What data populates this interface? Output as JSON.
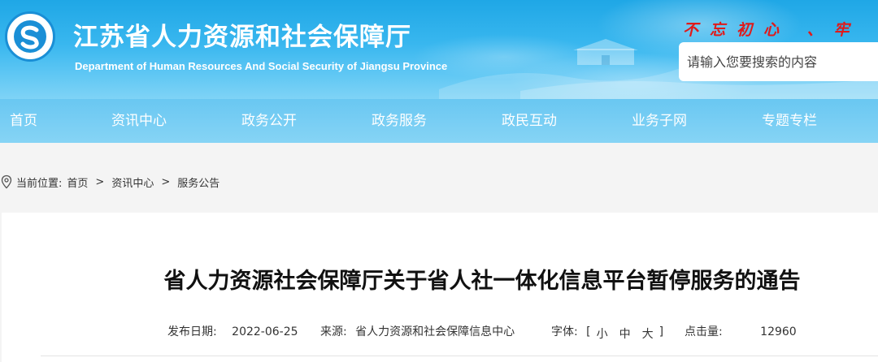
{
  "header": {
    "title_cn": "江苏省人力资源和社会保障厅",
    "title_en": "Department of Human Resources And Social Security of Jiangsu Province",
    "slogan": "不忘初心 、牢",
    "search": {
      "placeholder": "请输入您要搜索的内容",
      "value": ""
    }
  },
  "nav": {
    "items": [
      {
        "label": "首页"
      },
      {
        "label": "资讯中心"
      },
      {
        "label": "政务公开"
      },
      {
        "label": "政务服务"
      },
      {
        "label": "政民互动"
      },
      {
        "label": "业务子网"
      },
      {
        "label": "专题专栏"
      }
    ]
  },
  "breadcrumb": {
    "prefix": "当前位置:",
    "items": [
      {
        "label": "首页"
      },
      {
        "label": "资讯中心"
      },
      {
        "label": "服务公告"
      }
    ],
    "separator": ">"
  },
  "article": {
    "title": "省人力资源社会保障厅关于省人社一体化信息平台暂停服务的通告",
    "meta": {
      "date_label": "发布日期:",
      "date": "2022-06-25",
      "source_label": "来源:",
      "source": "省人力资源和社会保障信息中心",
      "font_label": "字体:",
      "font_open": "[",
      "font_small": "小",
      "font_medium": "中",
      "font_large": "大",
      "font_close": "]",
      "clicks_label": "点击量:",
      "clicks": "12960"
    }
  },
  "colors": {
    "header_blue": "#1fa7e6",
    "nav_blue": "#69c7f2",
    "slogan_red": "#e01a1a"
  },
  "icons": [
    "logo-emblem-icon",
    "location-pin-icon"
  ]
}
